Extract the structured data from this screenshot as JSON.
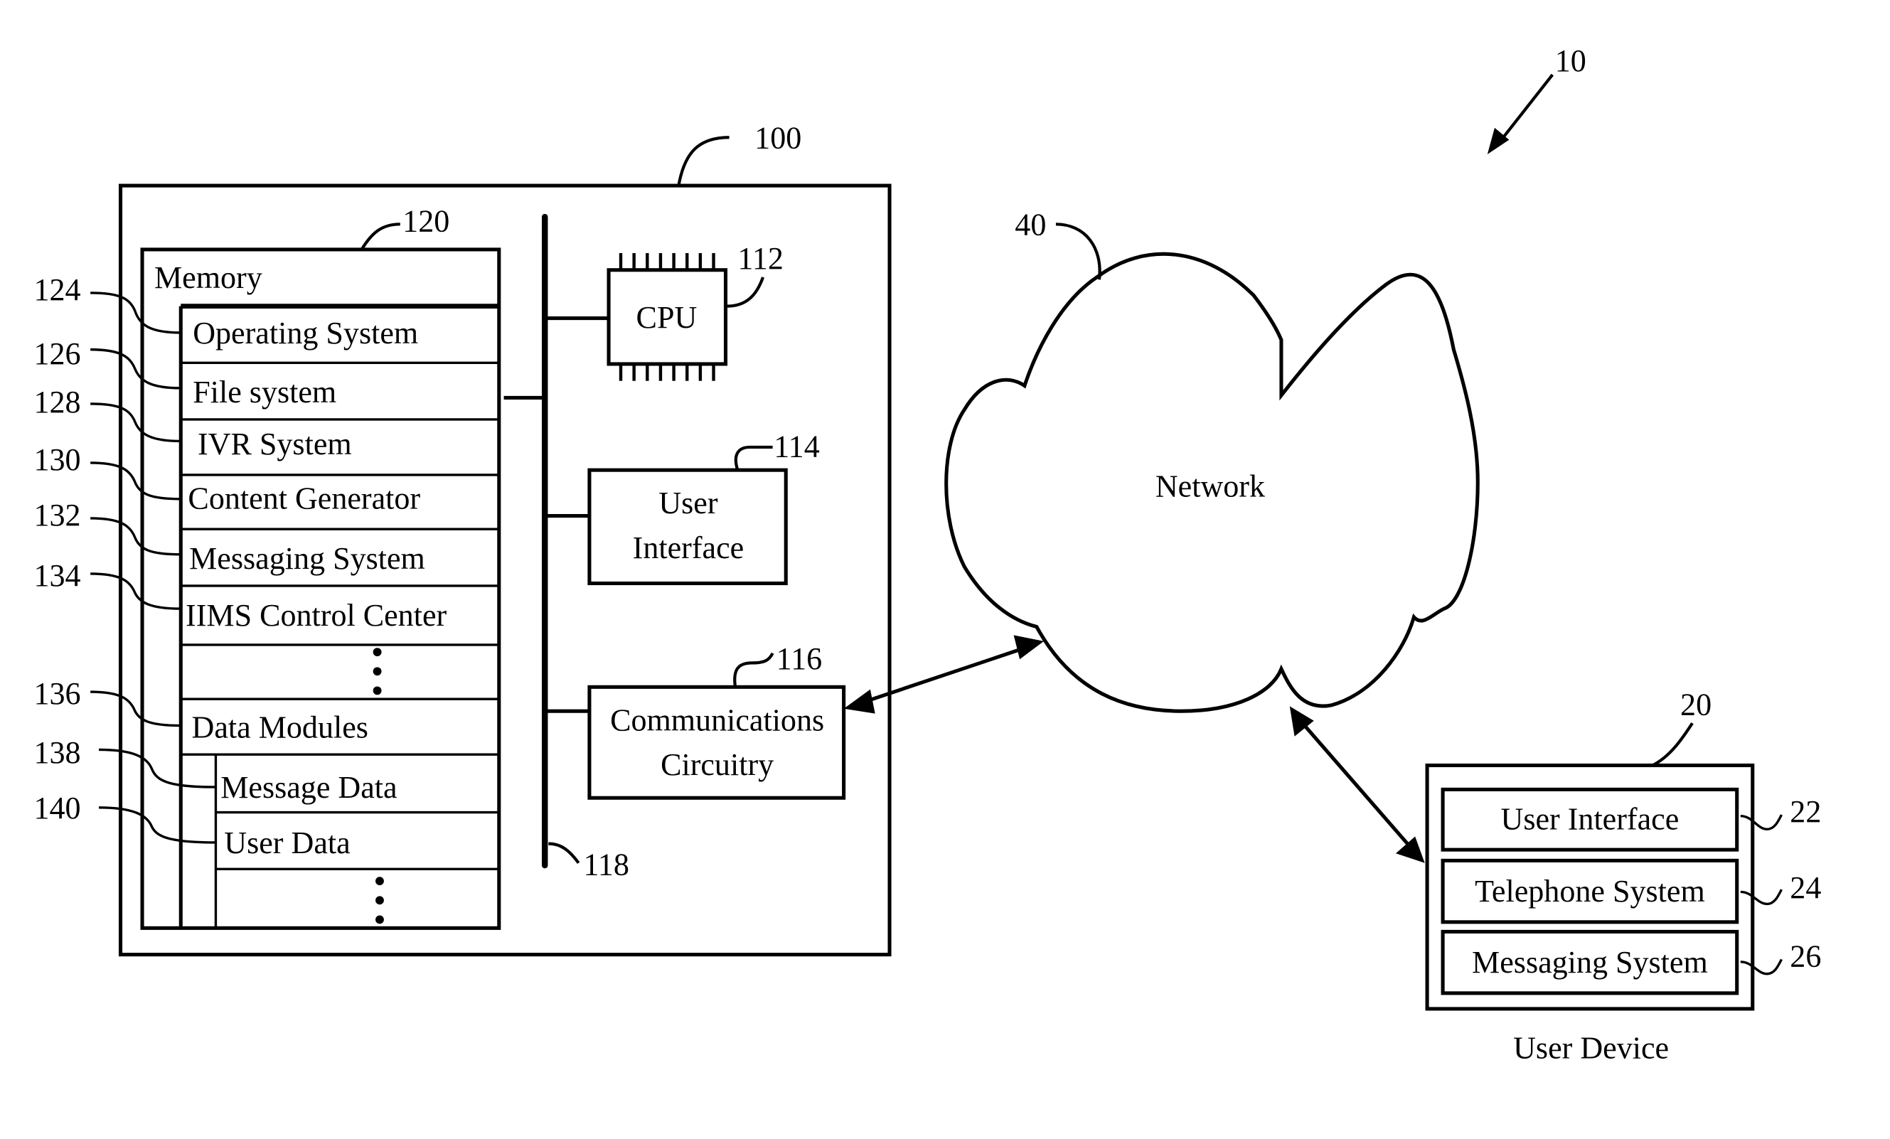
{
  "figure": {
    "ref": "10",
    "server": {
      "ref": "100",
      "memory": {
        "ref": "120",
        "title": "Memory",
        "rows": [
          {
            "ref": "124",
            "label": "Operating System"
          },
          {
            "ref": "126",
            "label": "File system"
          },
          {
            "ref": "128",
            "label": "IVR System"
          },
          {
            "ref": "130",
            "label": "Content Generator"
          },
          {
            "ref": "132",
            "label": "Messaging System"
          },
          {
            "ref": "134",
            "label": "IIMS Control Center"
          },
          {
            "ref": "136",
            "label": "Data Modules"
          },
          {
            "ref": "138",
            "label": "Message Data"
          },
          {
            "ref": "140",
            "label": "User Data"
          }
        ],
        "ellipsis": "⋮"
      },
      "bus_ref": "118",
      "cpu": {
        "ref": "112",
        "label": "CPU"
      },
      "user_interface": {
        "ref": "114",
        "line1": "User",
        "line2": "Interface"
      },
      "comms": {
        "ref": "116",
        "line1": "Communications",
        "line2": "Circuitry"
      }
    },
    "network": {
      "ref": "40",
      "label": "Network"
    },
    "user_device": {
      "ref": "20",
      "caption": "User Device",
      "rows": [
        {
          "ref": "22",
          "label": "User Interface"
        },
        {
          "ref": "24",
          "label": "Telephone System"
        },
        {
          "ref": "26",
          "label": "Messaging System"
        }
      ]
    }
  }
}
